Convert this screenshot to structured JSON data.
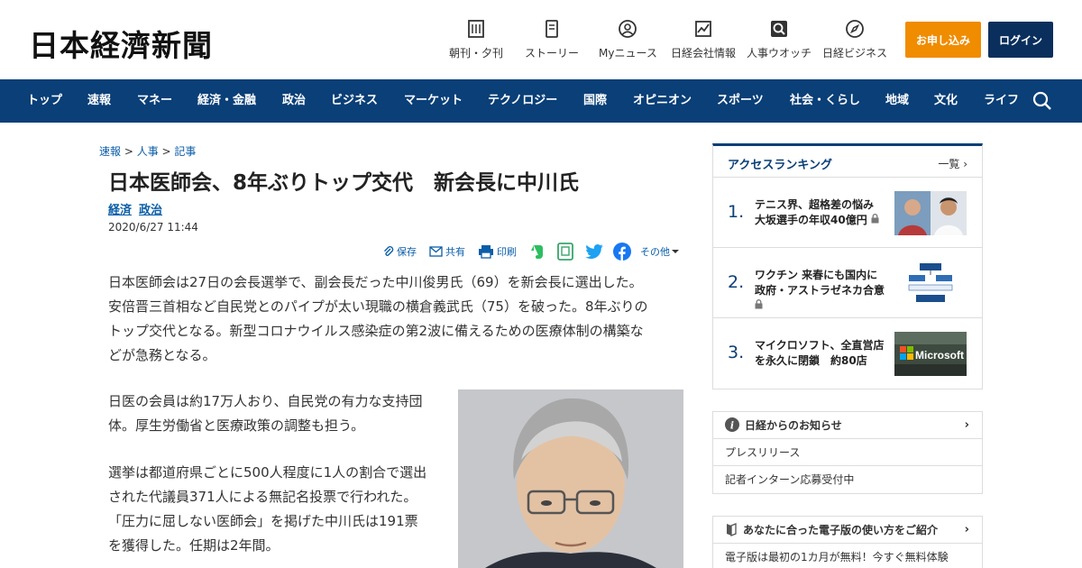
{
  "header": {
    "logo": "日本経濟新聞",
    "nav": [
      {
        "label": "朝刊・夕刊",
        "icon": "newspaper-icon"
      },
      {
        "label": "ストーリー",
        "icon": "story-icon"
      },
      {
        "label": "Myニュース",
        "icon": "user-icon"
      },
      {
        "label": "日経会社情報",
        "icon": "chart-icon"
      },
      {
        "label": "人事ウオッチ",
        "icon": "search-person-icon"
      },
      {
        "label": "日経ビジネス",
        "icon": "compass-icon"
      }
    ],
    "subscribe_label": "お申し込み",
    "login_label": "ログイン"
  },
  "main_nav": [
    "トップ",
    "速報",
    "マネー",
    "経済・金融",
    "政治",
    "ビジネス",
    "マーケット",
    "テクノロジー",
    "国際",
    "オピニオン",
    "スポーツ",
    "社会・くらし",
    "地域",
    "文化",
    "ライフ"
  ],
  "article": {
    "breadcrumb": [
      "速報",
      "人事",
      "記事"
    ],
    "title": "日本医師会、8年ぶりトップ交代　新会長に中川氏",
    "tags": [
      "経済",
      "政治"
    ],
    "date": "2020/6/27 11:44",
    "tools": {
      "save": "保存",
      "share": "共有",
      "print": "印刷",
      "more": "その他"
    },
    "paragraphs": [
      [
        "日本医師会は27日の会長選挙で、副会長だった中川俊男氏（69）を新会長に選出した。",
        "安倍晋三首相など自民党とのパイプが太い現職の横倉義武氏（75）を破った。8年ぶりの",
        "トップ交代となる。新型コロナウイルス感染症の第2波に備えるための医療体制の構築な",
        "どが急務となる。"
      ],
      [
        "日医の会員は約17万人おり、自民党の有力な支持団",
        "体。厚生労働省と医療政策の調整も担う。"
      ],
      [
        "選挙は都道府県ごとに500人程度に1人の割合で選出",
        "された代議員371人による無記名投票で行われた。",
        "「圧力に屈しない医師会」を掲げた中川氏は191票",
        "を獲得した。任期は2年間。"
      ]
    ]
  },
  "sidebar": {
    "ranking_title": "アクセスランキング",
    "ranking_more": "一覧",
    "ranking": [
      {
        "rank": "1.",
        "lines": [
          "テニス界、超格差の悩み",
          "大坂選手の年収40億円"
        ],
        "locked": true
      },
      {
        "rank": "2.",
        "lines": [
          "ワクチン 来春にも国内に",
          "政府・アストラゼネカ合意"
        ],
        "locked": true
      },
      {
        "rank": "3.",
        "lines": [
          "マイクロソフト、全直営店",
          "を永久に閉鎖　約80店"
        ],
        "locked": false
      }
    ],
    "ranking_image3_text": "Microsoft",
    "notice_title": "日経からのお知らせ",
    "notice_items": [
      "プレスリリース",
      "記者インターン応募受付中"
    ],
    "ebook_title": "あなたに合った電子版の使い方をご紹介",
    "ebook_items": [
      "電子版は最初の1カ月が無料！今すぐ無料体験"
    ]
  },
  "colors": {
    "nav_bg": "#0a3f77",
    "subscribe": "#f08c00",
    "login": "#0a2f5c",
    "link": "#0b5ea8"
  }
}
